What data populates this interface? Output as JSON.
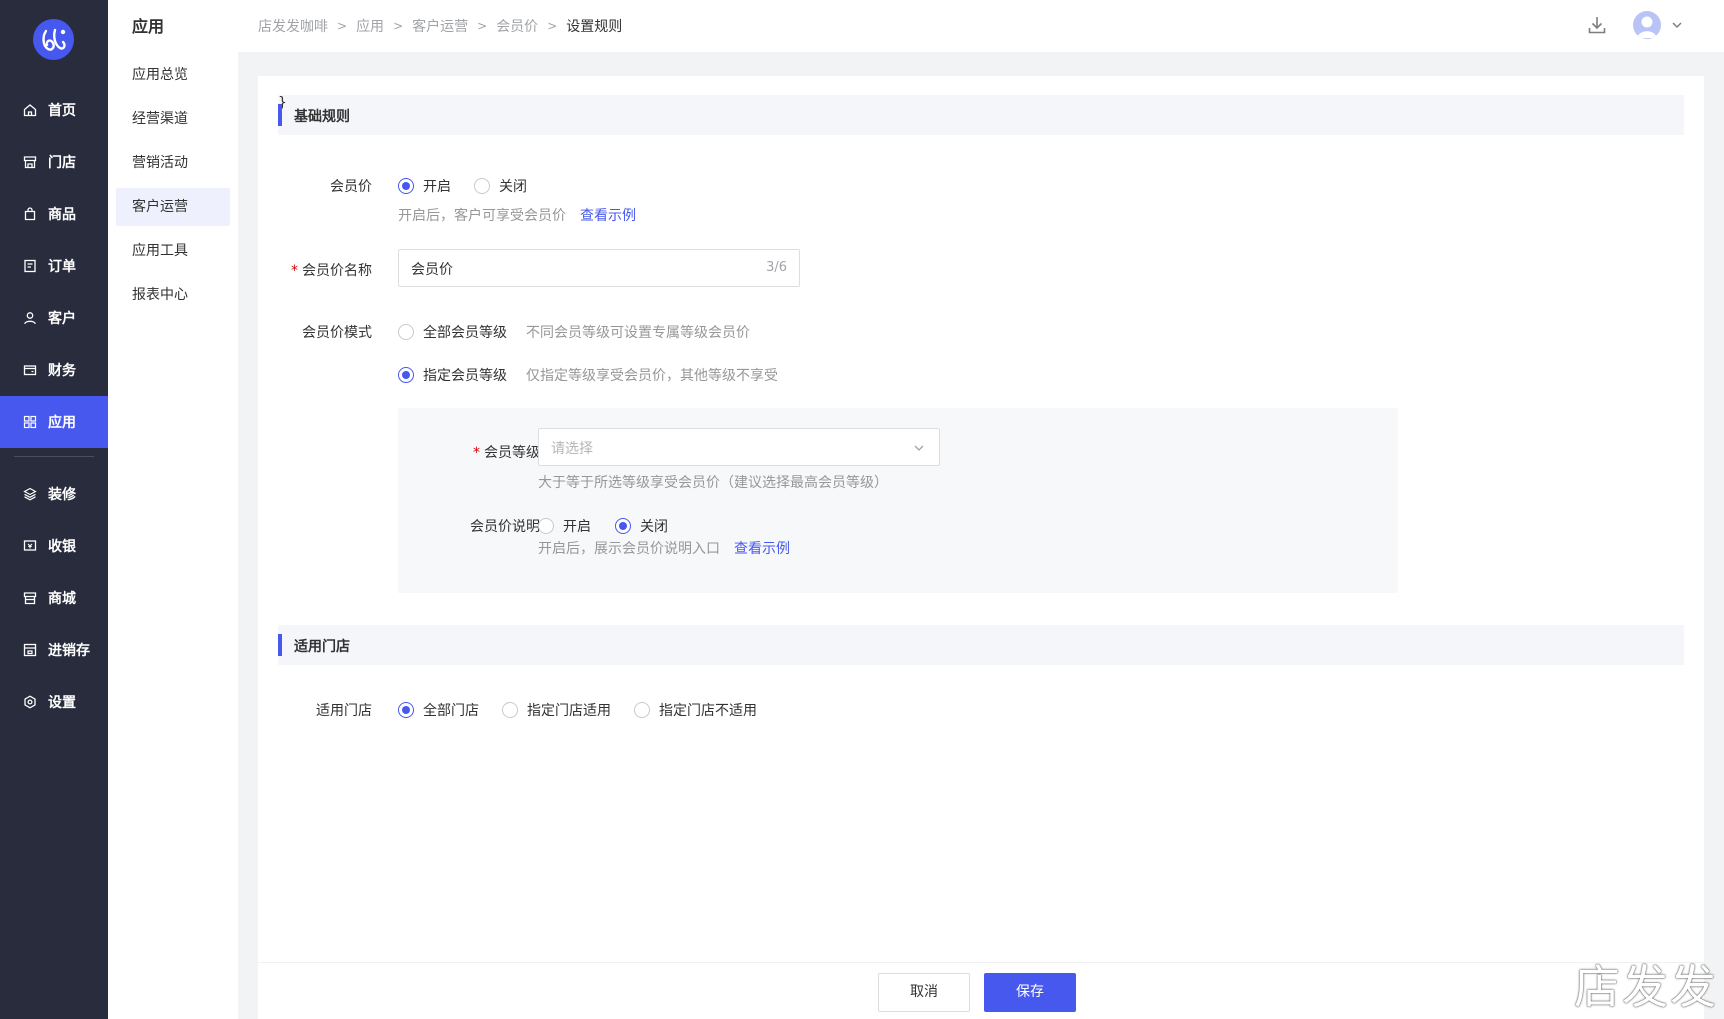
{
  "nav": {
    "items": [
      {
        "label": "首页",
        "icon": "home-icon"
      },
      {
        "label": "门店",
        "icon": "store-icon"
      },
      {
        "label": "商品",
        "icon": "bag-icon"
      },
      {
        "label": "订单",
        "icon": "order-icon"
      },
      {
        "label": "客户",
        "icon": "user-icon"
      },
      {
        "label": "财务",
        "icon": "wallet-icon"
      },
      {
        "label": "应用",
        "icon": "apps-icon",
        "active": true
      },
      {
        "label": "装修",
        "icon": "layers-icon"
      },
      {
        "label": "收银",
        "icon": "cashier-icon"
      },
      {
        "label": "商城",
        "icon": "shop-icon"
      },
      {
        "label": "进销存",
        "icon": "inventory-icon"
      },
      {
        "label": "设置",
        "icon": "settings-icon"
      }
    ]
  },
  "subnav": {
    "title": "应用",
    "items": [
      {
        "label": "应用总览"
      },
      {
        "label": "经营渠道"
      },
      {
        "label": "营销活动"
      },
      {
        "label": "客户运营",
        "active": true
      },
      {
        "label": "应用工具"
      },
      {
        "label": "报表中心"
      }
    ]
  },
  "breadcrumb": [
    "店发发咖啡",
    "应用",
    "客户运营",
    "会员价",
    "设置规则"
  ],
  "sections": {
    "basic": "基础规则",
    "stores": "适用门店"
  },
  "form": {
    "member_price": {
      "label": "会员价",
      "options": [
        "开启",
        "关闭"
      ],
      "selected": "开启",
      "hint": "开启后，客户可享受会员价",
      "hint_link": "查看示例"
    },
    "name": {
      "label": "会员价名称",
      "value": "会员价",
      "counter": "3/6"
    },
    "mode": {
      "label": "会员价模式",
      "option_all": "全部会员等级",
      "option_all_hint": "不同会员等级可设置专属等级会员价",
      "option_specific": "指定会员等级",
      "option_specific_hint": "仅指定等级享受会员价，其他等级不享受",
      "selected": "指定会员等级"
    },
    "level": {
      "label": "会员等级",
      "placeholder": "请选择",
      "hint": "大于等于所选等级享受会员价（建议选择最高会员等级）"
    },
    "description": {
      "label": "会员价说明",
      "options": [
        "开启",
        "关闭"
      ],
      "selected": "关闭",
      "hint": "开启后，展示会员价说明入口",
      "hint_link": "查看示例"
    },
    "stores": {
      "label": "适用门店",
      "options": [
        "全部门店",
        "指定门店适用",
        "指定门店不适用"
      ],
      "selected": "全部门店"
    }
  },
  "footer": {
    "cancel": "取消",
    "save": "保存"
  },
  "watermark": "店发发",
  "colors": {
    "accent": "#4758ee",
    "nav_bg": "#282c3c"
  }
}
